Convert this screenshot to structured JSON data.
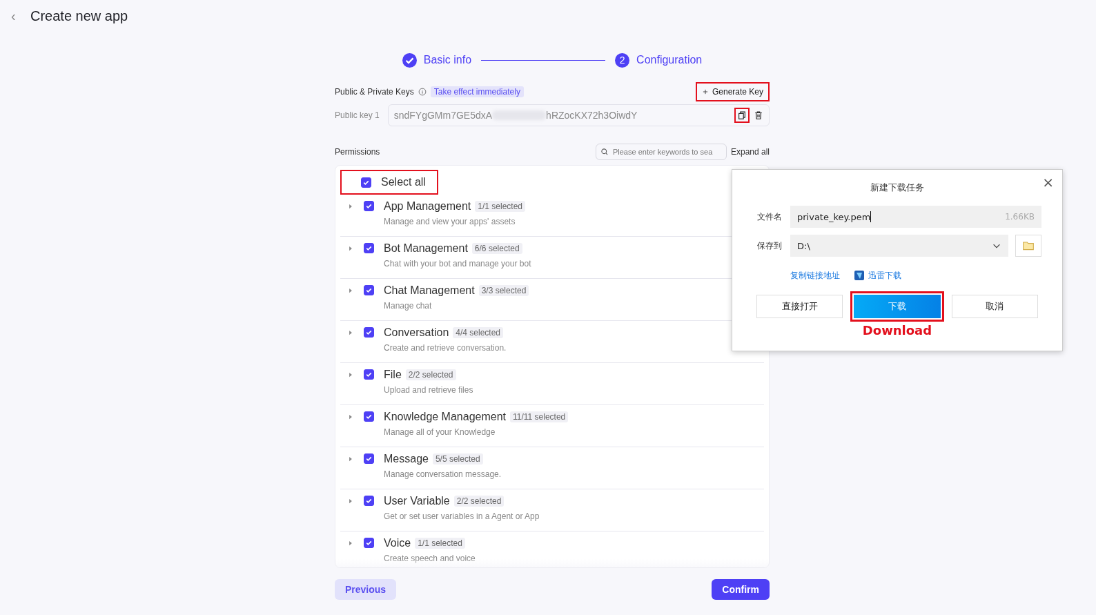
{
  "header": {
    "back": "‹",
    "title": "Create new app"
  },
  "steps": [
    {
      "label": "Basic info",
      "completed": true
    },
    {
      "label": "Configuration",
      "completed": false,
      "number": "2"
    }
  ],
  "keys": {
    "label": "Public & Private Keys",
    "tag": "Take effect immediately",
    "generate": {
      "label": "Generate Key",
      "highlighted": true
    },
    "public_key": {
      "label": "Public key 1",
      "value_start": "sndFYgGMm7GE5dxA",
      "value_end": "hRZocKX72h3OiwdY",
      "redacted": true,
      "copy_highlighted": true
    }
  },
  "permissions": {
    "label": "Permissions",
    "search": {
      "placeholder": "Please enter keywords to sea"
    },
    "expand_all": "Expand all",
    "select_all": {
      "label": "Select all",
      "checked": true,
      "highlighted": true
    },
    "items": [
      {
        "name": "App Management",
        "count": "1/1 selected",
        "description": "Manage and view your apps' assets",
        "checked": true,
        "expanded": false
      },
      {
        "name": "Bot Management",
        "count": "6/6 selected",
        "description": "Chat with your bot and manage your bot",
        "checked": true,
        "expanded": false
      },
      {
        "name": "Chat Management",
        "count": "3/3 selected",
        "description": "Manage chat",
        "checked": true,
        "expanded": false
      },
      {
        "name": "Conversation",
        "count": "4/4 selected",
        "description": "Create and retrieve conversation.",
        "checked": true,
        "expanded": false
      },
      {
        "name": "File",
        "count": "2/2 selected",
        "description": "Upload and retrieve files",
        "checked": true,
        "expanded": false
      },
      {
        "name": "Knowledge Management",
        "count": "11/11 selected",
        "description": "Manage all of your Knowledge",
        "checked": true,
        "expanded": false
      },
      {
        "name": "Message",
        "count": "5/5 selected",
        "description": "Manage conversation message.",
        "checked": true,
        "expanded": false
      },
      {
        "name": "User Variable",
        "count": "2/2 selected",
        "description": "Get or set user variables in a Agent or App",
        "checked": true,
        "expanded": false
      },
      {
        "name": "Voice",
        "count": "1/1 selected",
        "description": "Create speech and voice",
        "checked": true,
        "expanded": false
      }
    ]
  },
  "footer": {
    "previous": "Previous",
    "confirm": "Confirm"
  },
  "download_dialog": {
    "title": "新建下载任务",
    "close": "×",
    "filename_label": "文件名",
    "filename": "private_key.pem",
    "size": "1.66KB",
    "save_label": "保存到",
    "save_path": "D:\\",
    "copy_link": "复制链接地址",
    "thunder": "迅雷下载",
    "buttons": [
      {
        "label": "直接打开",
        "kind": "default",
        "highlighted": false
      },
      {
        "label": "下载",
        "kind": "primary",
        "highlighted": true
      },
      {
        "label": "取消",
        "kind": "default",
        "highlighted": false
      }
    ],
    "annotation": "Download"
  }
}
